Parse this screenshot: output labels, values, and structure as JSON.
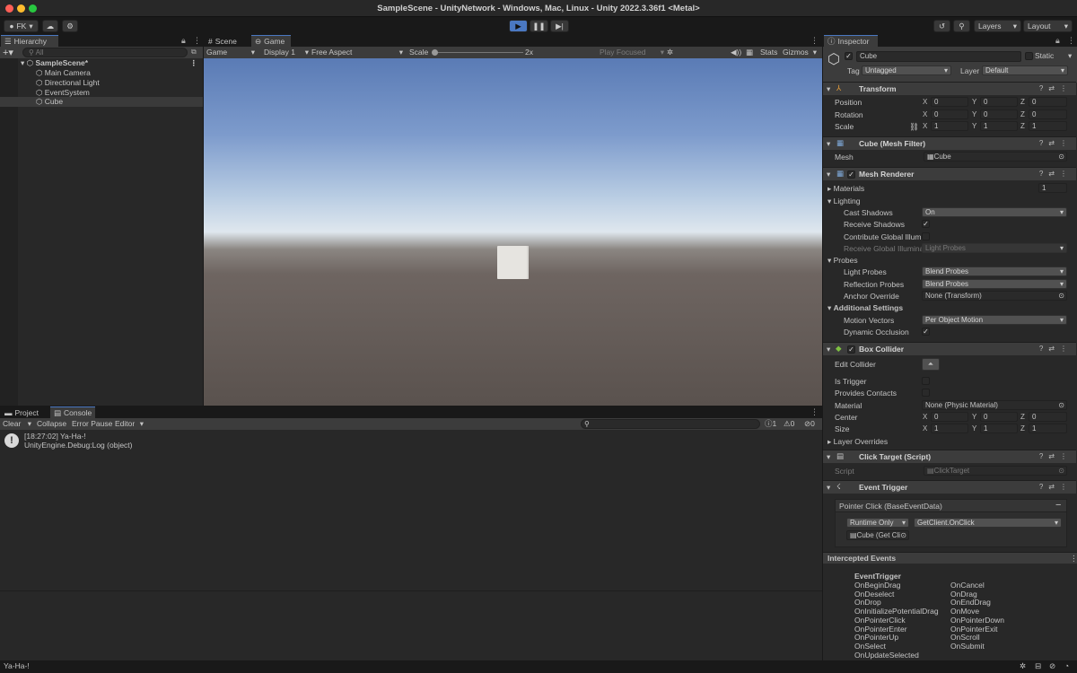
{
  "window": {
    "title": "SampleScene - UnityNetwork - Windows, Mac, Linux - Unity 2022.3.36f1 <Metal>"
  },
  "toolbar": {
    "account": "FK",
    "layers": "Layers",
    "layout": "Layout"
  },
  "hierarchy": {
    "tab": "Hierarchy",
    "search_placeholder": "All",
    "scene": "SampleScene*",
    "items": [
      "Main Camera",
      "Directional Light",
      "EventSystem",
      "Cube"
    ]
  },
  "game": {
    "tabs": [
      "Scene",
      "Game"
    ],
    "display_mode": "Game",
    "display": "Display 1",
    "aspect": "Free Aspect",
    "scale_label": "Scale",
    "scale_value": "2x",
    "play_focused": "Play Focused",
    "stats": "Stats",
    "gizmos": "Gizmos"
  },
  "console": {
    "tabs": [
      "Project",
      "Console"
    ],
    "clear": "Clear",
    "collapse": "Collapse",
    "error_pause": "Error Pause",
    "editor": "Editor",
    "counts": {
      "info": "1",
      "warn": "0",
      "error": "0"
    },
    "entries": [
      {
        "line1": "[18:27:02] Ya-Ha-!",
        "line2": "UnityEngine.Debug:Log (object)"
      }
    ]
  },
  "statusbar": {
    "message": "Ya-Ha-!"
  },
  "inspector": {
    "tab": "Inspector",
    "object_name": "Cube",
    "static_label": "Static",
    "tag_label": "Tag",
    "tag": "Untagged",
    "layer_label": "Layer",
    "layer": "Default",
    "transform": {
      "title": "Transform",
      "position_label": "Position",
      "rotation_label": "Rotation",
      "scale_label": "Scale",
      "position": [
        "0",
        "0",
        "0"
      ],
      "rotation": [
        "0",
        "0",
        "0"
      ],
      "scale": [
        "1",
        "1",
        "1"
      ]
    },
    "mesh_filter": {
      "title": "Cube (Mesh Filter)",
      "mesh_label": "Mesh",
      "mesh": "Cube"
    },
    "mesh_renderer": {
      "title": "Mesh Renderer",
      "materials_label": "Materials",
      "materials_count": "1",
      "lighting_label": "Lighting",
      "cast_shadows_label": "Cast Shadows",
      "cast_shadows": "On",
      "receive_shadows_label": "Receive Shadows",
      "contribute_gi_label": "Contribute Global Illumi",
      "receive_gi_label": "Receive Global Illumina",
      "receive_gi": "Light Probes",
      "probes_label": "Probes",
      "light_probes_label": "Light Probes",
      "light_probes": "Blend Probes",
      "reflection_probes_label": "Reflection Probes",
      "reflection_probes": "Blend Probes",
      "anchor_override_label": "Anchor Override",
      "anchor_override": "None (Transform)",
      "additional_label": "Additional Settings",
      "motion_vectors_label": "Motion Vectors",
      "motion_vectors": "Per Object Motion",
      "dynamic_occlusion_label": "Dynamic Occlusion"
    },
    "box_collider": {
      "title": "Box Collider",
      "edit_collider_label": "Edit Collider",
      "is_trigger_label": "Is Trigger",
      "provides_contacts_label": "Provides Contacts",
      "material_label": "Material",
      "material": "None (Physic Material)",
      "center_label": "Center",
      "center": [
        "0",
        "0",
        "0"
      ],
      "size_label": "Size",
      "size": [
        "1",
        "1",
        "1"
      ],
      "layer_overrides_label": "Layer Overrides"
    },
    "click_target": {
      "title": "Click Target (Script)",
      "script_label": "Script",
      "script": "ClickTarget"
    },
    "event_trigger": {
      "title": "Event Trigger",
      "entry": "Pointer Click (BaseEventData)",
      "runtime": "Runtime Only",
      "function": "GetClient.OnClick",
      "object": "Cube (Get Cli"
    },
    "intercepted": {
      "title": "Intercepted Events",
      "header": "EventTrigger",
      "left": [
        "OnBeginDrag",
        "OnDeselect",
        "OnDrop",
        "OnInitializePotentialDrag",
        "OnPointerClick",
        "OnPointerEnter",
        "OnPointerUp",
        "OnSelect",
        "OnUpdateSelected"
      ],
      "right": [
        "OnCancel",
        "OnDrag",
        "OnEndDrag",
        "OnMove",
        "OnPointerDown",
        "OnPointerExit",
        "OnScroll",
        "OnSubmit"
      ]
    }
  },
  "colors": {
    "accent": "#4a78c2",
    "panel": "#282828",
    "header": "#3c3c3c",
    "selection": "#3a3a3a"
  }
}
